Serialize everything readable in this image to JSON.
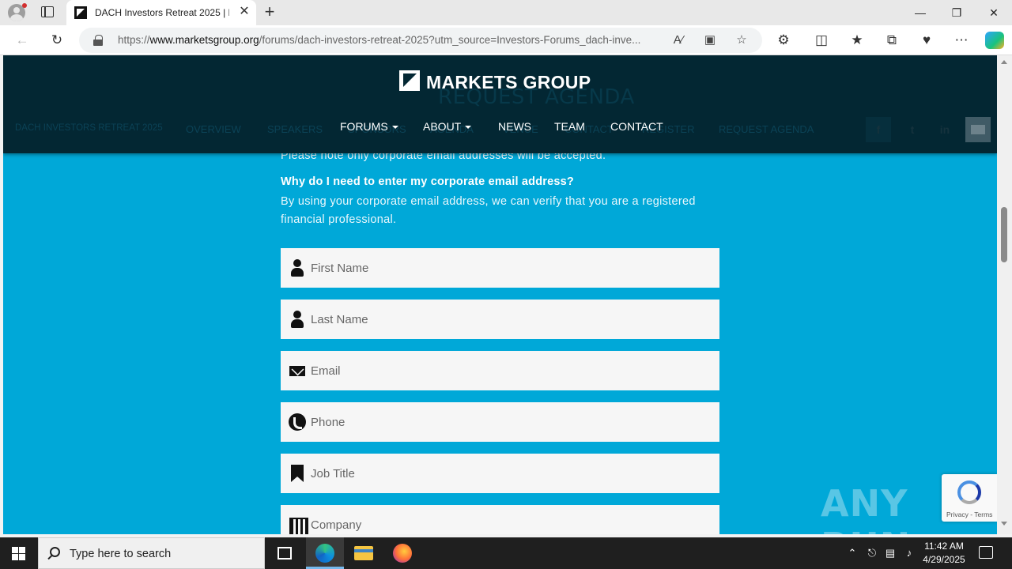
{
  "browser": {
    "tab_title": "DACH Investors Retreat 2025 | Ma",
    "tab_close": "✕",
    "new_tab": "+",
    "url_prefix": "https://",
    "url_domain": "www.marketsgroup.org",
    "url_path": "/forums/dach-investors-retreat-2025?utm_source=Investors-Forums_dach-inve...",
    "window_controls": [
      "—",
      "❐",
      "✕"
    ],
    "icons": [
      "back-icon",
      "refresh-icon",
      "lock-icon",
      "read-aloud-icon",
      "immersive-reader-icon",
      "favorite-icon",
      "extensions-icon",
      "split-screen-icon",
      "favorites-icon",
      "collections-icon",
      "browser-essentials-icon",
      "more-icon",
      "copilot-icon"
    ]
  },
  "site": {
    "logo_text": "MARKETS GROUP",
    "ghost_title": "REQUEST AGENDA",
    "main_nav": [
      {
        "label": "FORUMS",
        "dropdown": true
      },
      {
        "label": "ABOUT",
        "dropdown": true
      },
      {
        "label": "NEWS",
        "dropdown": false
      },
      {
        "label": "TEAM",
        "dropdown": false
      },
      {
        "label": "CONTACT",
        "dropdown": false
      }
    ],
    "ghost_nav": [
      "DACH INVESTORS RETREAT 2025",
      "OVERVIEW",
      "SPEAKERS",
      "SPONSORS",
      "AGENDA",
      "VENUE",
      "CONTACT",
      "REGISTER",
      "REQUEST AGENDA"
    ],
    "social": [
      "f",
      "t",
      "in"
    ]
  },
  "content": {
    "note": "Please note only corporate email addresses will be accepted.",
    "question": "Why do I need to enter my corporate email address?",
    "answer": "By using your corporate email address, we can verify that you are a registered financial professional.",
    "fields": {
      "first_name": "First Name",
      "last_name": "Last Name",
      "email": "Email",
      "phone": "Phone",
      "job_title": "Job Title",
      "company": "Company"
    },
    "recaptcha": "Privacy - Terms",
    "watermark": "ANY RUN"
  },
  "taskbar": {
    "search_placeholder": "Type here to search",
    "time": "11:42 AM",
    "date": "4/29/2025"
  }
}
